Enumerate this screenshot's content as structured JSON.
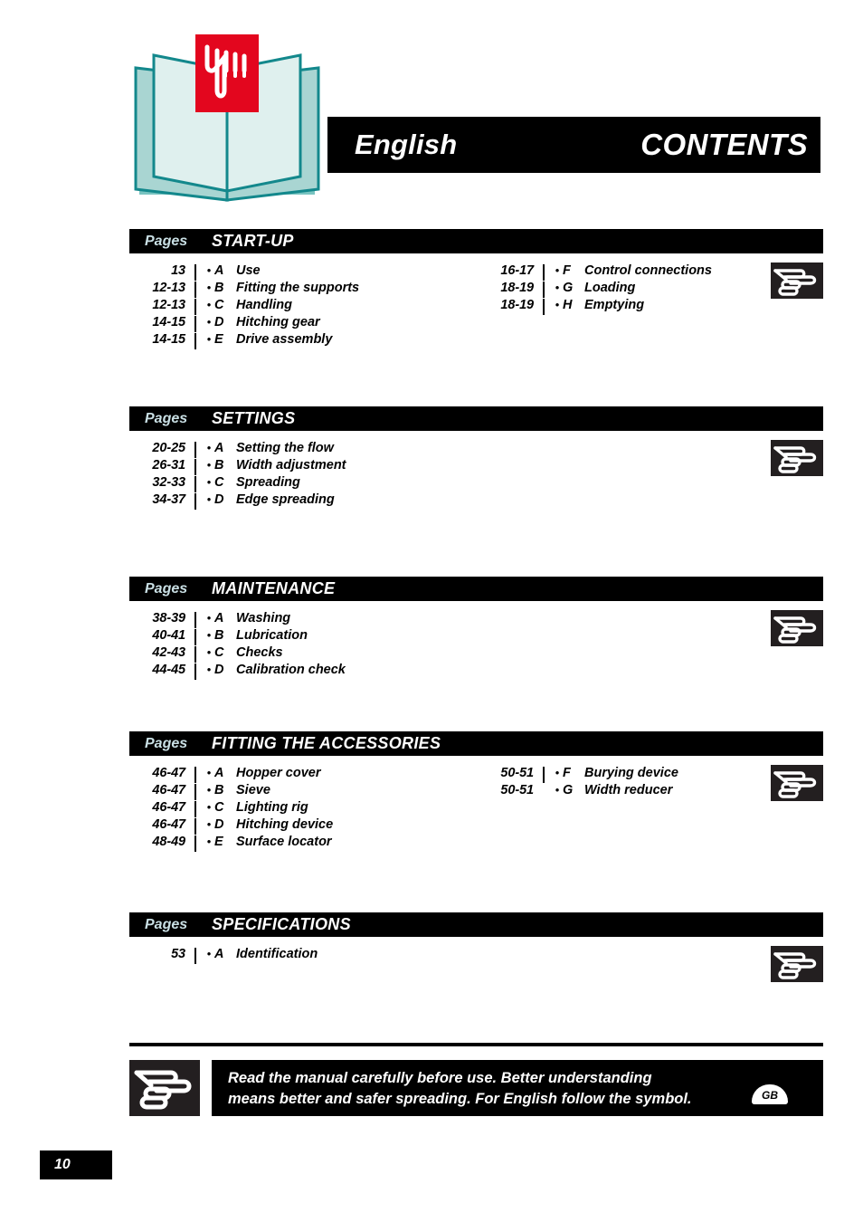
{
  "masthead": {
    "language_title": "English",
    "contents_title": "CONTENTS",
    "book_icon": "open-book-icon",
    "brand_icon": "pointing-hand-brand-logo"
  },
  "pages_label": "Pages",
  "sections": [
    {
      "title": "START-UP",
      "symbol": "pointing-hand-icon",
      "left_entries": [
        {
          "pages": "13",
          "letter": "A",
          "label": "Use"
        },
        {
          "pages": "12-13",
          "letter": "B",
          "label": "Fitting the supports"
        },
        {
          "pages": "12-13",
          "letter": "C",
          "label": "Handling"
        },
        {
          "pages": "14-15",
          "letter": "D",
          "label": "Hitching gear"
        },
        {
          "pages": "14-15",
          "letter": "E",
          "label": "Drive assembly"
        }
      ],
      "right_entries": [
        {
          "pages": "16-17",
          "letter": "F",
          "label": "Control connections"
        },
        {
          "pages": "18-19",
          "letter": "G",
          "label": "Loading"
        },
        {
          "pages": "18-19",
          "letter": "H",
          "label": "Emptying"
        }
      ]
    },
    {
      "title": "SETTINGS",
      "symbol": "pointing-hand-icon",
      "left_entries": [
        {
          "pages": "20-25",
          "letter": "A",
          "label": "Setting the flow"
        },
        {
          "pages": "26-31",
          "letter": "B",
          "label": "Width adjustment"
        },
        {
          "pages": "32-33",
          "letter": "C",
          "label": "Spreading"
        },
        {
          "pages": "34-37",
          "letter": "D",
          "label": "Edge spreading"
        }
      ],
      "right_entries": []
    },
    {
      "title": "MAINTENANCE",
      "symbol": "pointing-hand-icon",
      "left_entries": [
        {
          "pages": "38-39",
          "letter": "A",
          "label": "Washing"
        },
        {
          "pages": "40-41",
          "letter": "B",
          "label": "Lubrication"
        },
        {
          "pages": "42-43",
          "letter": "C",
          "label": "Checks"
        },
        {
          "pages": "44-45",
          "letter": "D",
          "label": "Calibration check"
        }
      ],
      "right_entries": []
    },
    {
      "title": "FITTING THE ACCESSORIES",
      "symbol": "pointing-hand-icon",
      "left_entries": [
        {
          "pages": "46-47",
          "letter": "A",
          "label": "Hopper cover"
        },
        {
          "pages": "46-47",
          "letter": "B",
          "label": "Sieve"
        },
        {
          "pages": "46-47",
          "letter": "C",
          "label": "Lighting rig"
        },
        {
          "pages": "46-47",
          "letter": "D",
          "label": "Hitching device"
        },
        {
          "pages": "48-49",
          "letter": "E",
          "label": "Surface locator"
        }
      ],
      "right_entries": [
        {
          "pages": "50-51",
          "letter": "F",
          "label": "Burying device"
        },
        {
          "pages": "50-51",
          "letter": "G",
          "label": "Width reducer",
          "no_rule": true
        }
      ]
    },
    {
      "title": "SPECIFICATIONS",
      "symbol": "pointing-hand-icon",
      "left_entries": [
        {
          "pages": "53",
          "letter": "A",
          "label": "Identification"
        }
      ],
      "right_entries": []
    }
  ],
  "footer": {
    "symbol": "pointing-hand-icon",
    "line1": "Read  the manual carefully before use. Better understanding",
    "line2": "means better and safer spreading. For English follow the symbol.",
    "country_badge": "GB"
  },
  "page_number": "10",
  "colors": {
    "bar_background": "#000000",
    "pages_label": "#c9dfe4",
    "brand_red": "#e3061e",
    "book_teal": "#159b9e",
    "book_light": "#d4e9e7",
    "book_mid": "#a9d5d2"
  }
}
